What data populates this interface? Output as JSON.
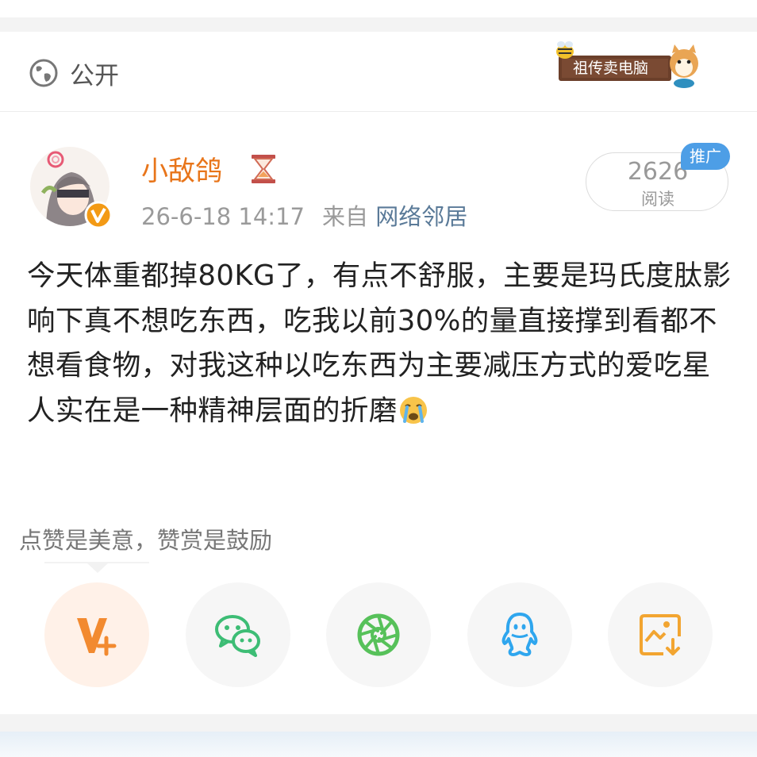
{
  "header": {
    "visibility_label": "公开",
    "globe_icon": "globe-icon",
    "sticker_text": "祖传卖电脑"
  },
  "post": {
    "username": "小敌鸽",
    "username_color": "#e8751a",
    "timestamp": "26-6-18 14:17",
    "source_prefix": "来自",
    "source_name": "网络邻居",
    "read_count": "2626",
    "read_label": "阅读",
    "promo_badge": "推广",
    "text": "今天体重都掉80KG了，有点不舒服，主要是玛氏度肽影响下真不想吃东西，吃我以前30%的量直接撑到看都不想看食物，对我这种以吃东西为主要减压方式的爱吃星人实在是一种精神层面的折磨"
  },
  "reward": {
    "prompt": "点赞是美意，赞赏是鼓励"
  },
  "share_buttons": [
    {
      "icon": "reward-v-plus-icon",
      "color": "#f28a30"
    },
    {
      "icon": "wechat-icon",
      "color": "#3dbd75"
    },
    {
      "icon": "moments-icon",
      "color": "#57c15a"
    },
    {
      "icon": "qq-icon",
      "color": "#2fa6ee"
    },
    {
      "icon": "save-image-icon",
      "color": "#f2a531"
    }
  ]
}
